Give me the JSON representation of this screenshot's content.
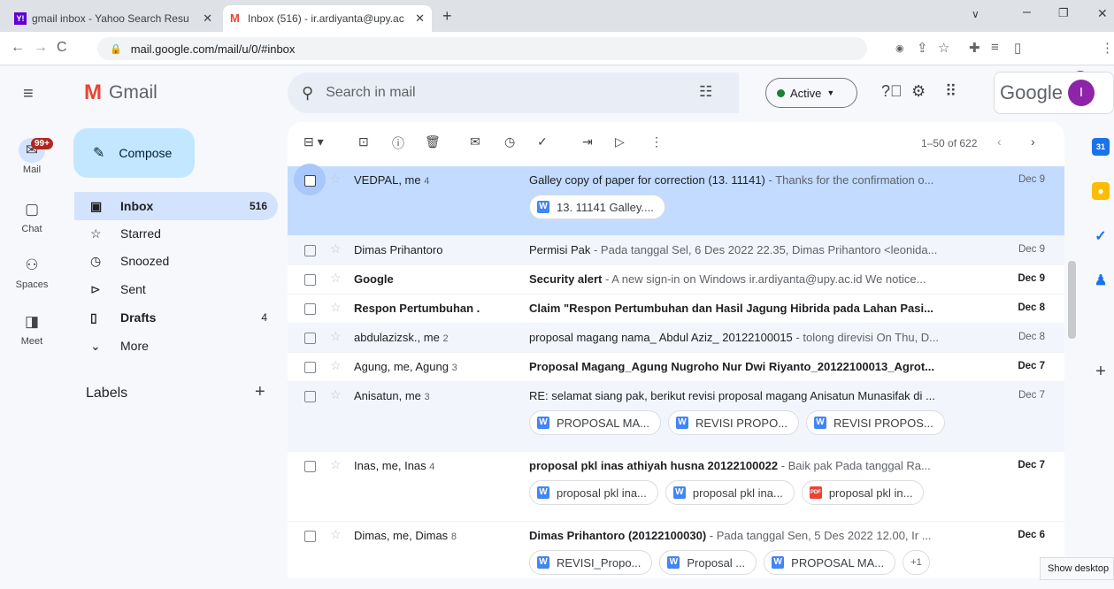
{
  "browser": {
    "tabs": [
      {
        "label": "gmail inbox - Yahoo Search Resu",
        "close": "✕"
      },
      {
        "label": "Inbox (516) - ir.ardiyanta@upy.ac",
        "close": "✕"
      }
    ],
    "new_tab": "+",
    "url": "mail.google.com/mail/u/0/#inbox",
    "profile_initial": "I"
  },
  "rail": {
    "badge": "99+",
    "items": [
      {
        "label": "Mail",
        "icon": "mail-icon"
      },
      {
        "label": "Chat",
        "icon": "chat-icon"
      },
      {
        "label": "Spaces",
        "icon": "spaces-icon"
      },
      {
        "label": "Meet",
        "icon": "meet-icon"
      }
    ]
  },
  "logo": {
    "text": "Gmail"
  },
  "compose": {
    "label": "Compose"
  },
  "sidebar": {
    "items": [
      {
        "label": "Inbox",
        "count": "516"
      },
      {
        "label": "Starred",
        "count": ""
      },
      {
        "label": "Snoozed",
        "count": ""
      },
      {
        "label": "Sent",
        "count": ""
      },
      {
        "label": "Drafts",
        "count": "4"
      },
      {
        "label": "More",
        "count": ""
      }
    ],
    "labels_title": "Labels",
    "labels_add": "+"
  },
  "header": {
    "search_placeholder": "Search in mail",
    "status": "Active",
    "google_text": "Google",
    "avatar_initial": "I"
  },
  "toolbar": {
    "pagination": "1–50 of 622"
  },
  "emails": [
    {
      "sender": "VEDPAL, me",
      "count": "4",
      "subject": "Galley copy of paper for correction (13. 11141)",
      "snippet": " - Thanks for the confirmation o...",
      "date": "Dec 9",
      "attachments": [
        "13. 11141 Galley...."
      ]
    },
    {
      "sender": "Dimas Prihantoro",
      "count": "",
      "subject": "Permisi Pak",
      "snippet": " - Pada tanggal Sel, 6 Des 2022 22.35, Dimas Prihantoro <leonida...",
      "date": "Dec 9",
      "attachments": []
    },
    {
      "sender": "Google",
      "count": "",
      "subject": "Security alert",
      "snippet": " - A new sign-in on Windows ir.ardiyanta@upy.ac.id We notice...",
      "date": "Dec 9",
      "attachments": []
    },
    {
      "sender": "Respon Pertumbuhan .",
      "count": "",
      "subject": "Claim \"Respon Pertumbuhan dan Hasil Jagung Hibrida pada Lahan Pasi...",
      "snippet": "",
      "date": "Dec 8",
      "attachments": []
    },
    {
      "sender": "abdulazizsk., me",
      "count": "2",
      "subject": "proposal magang nama_ Abdul Aziz_ 20122100015",
      "snippet": " - tolong direvisi On Thu, D...",
      "date": "Dec 8",
      "attachments": []
    },
    {
      "sender": "Agung, me, Agung",
      "count": "3",
      "subject": "Proposal Magang_Agung Nugroho Nur Dwi Riyanto_20122100013_Agrot...",
      "snippet": "",
      "date": "Dec 7",
      "attachments": []
    },
    {
      "sender": "Anisatun, me",
      "count": "3",
      "subject": "RE: selamat siang pak, berikut revisi proposal magang Anisatun Munasifak di ...",
      "snippet": "",
      "date": "Dec 7",
      "attachments": [
        "PROPOSAL MA...",
        "REVISI PROPO...",
        "REVISI PROPOS..."
      ]
    },
    {
      "sender": "Inas, me, Inas",
      "count": "4",
      "subject": "proposal pkl inas athiyah husna 20122100022",
      "snippet": " - Baik pak Pada tanggal Ra...",
      "date": "Dec 7",
      "attachments": [
        "proposal pkl ina...",
        "proposal pkl ina...",
        "proposal pkl in..."
      ]
    },
    {
      "sender": "Dimas, me, Dimas",
      "count": "8",
      "subject": "Dimas Prihantoro (20122100030)",
      "snippet": " - Pada tanggal Sen, 5 Des 2022 12.00, Ir ...",
      "date": "Dec 6",
      "attachments": [
        "REVISI_Propo...",
        "Proposal ...",
        "PROPOSAL MA...",
        "+1"
      ]
    }
  ],
  "tooltip": "Show desktop"
}
